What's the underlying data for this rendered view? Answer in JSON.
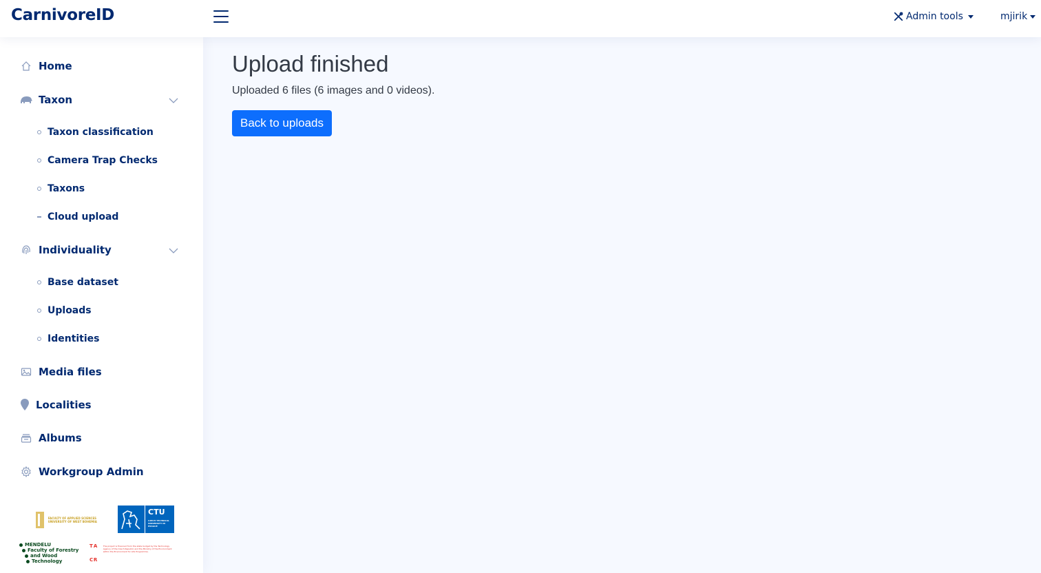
{
  "header": {
    "brand": "CarnivoreID",
    "admin_tools_label": "Admin tools",
    "user_label": "mjirik"
  },
  "sidebar": {
    "items": [
      {
        "label": "Home",
        "icon": "house-icon"
      },
      {
        "label": "Taxon",
        "icon": "animal-icon",
        "expanded": true,
        "children": [
          "Taxon classification",
          "Camera Trap Checks",
          "Taxons",
          "Cloud upload"
        ]
      },
      {
        "label": "Individuality",
        "icon": "fingerprint-icon",
        "expanded": true,
        "children": [
          "Base dataset",
          "Uploads",
          "Identities"
        ]
      },
      {
        "label": "Media files",
        "icon": "images-icon"
      },
      {
        "label": "Localities",
        "icon": "geo-pin-icon"
      },
      {
        "label": "Albums",
        "icon": "album-icon"
      },
      {
        "label": "Workgroup Admin",
        "icon": "gear-icon"
      }
    ],
    "logos": {
      "fas": "FACULTY OF APPLIED SCIENCES UNIVERSITY OF WEST BOHEMIA",
      "ctu": "CTU",
      "ctu_sub": "CZECH TECHNICAL UNIVERSITY IN PRAGUE",
      "mendelu": [
        "MENDELU",
        "Faculty of Forestry",
        "and Wood",
        "Technology"
      ],
      "tacr": [
        "T",
        "A",
        "C",
        "R"
      ],
      "tacr_desc": "The project is financed from the state budget by the Technology Agency of the Czech Republic and the Ministry of the Environment within the Environment for Life Programme."
    }
  },
  "main": {
    "title": "Upload finished",
    "message": "Uploaded 6 files (6 images and 0 videos).",
    "back_button": "Back to uploads"
  },
  "colors": {
    "brand": "#012970",
    "primary_button": "#0d6efd",
    "background": "#f6f9ff"
  }
}
